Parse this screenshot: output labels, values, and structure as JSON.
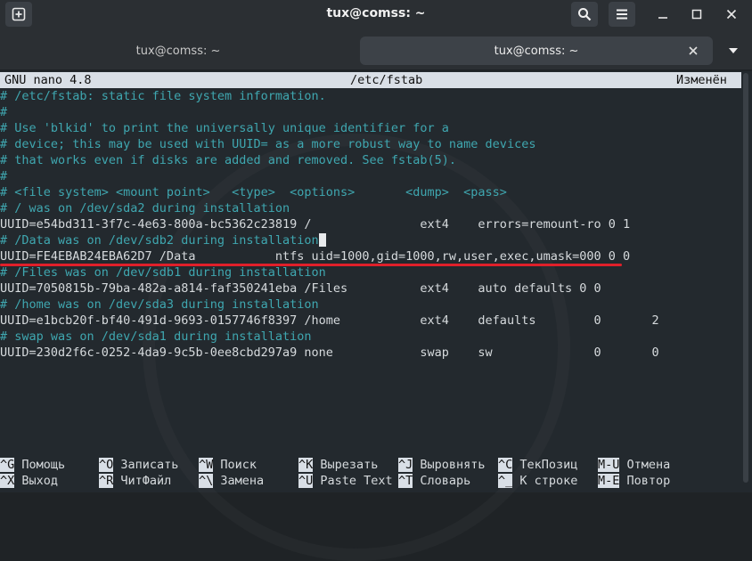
{
  "window": {
    "title": "tux@comss: ~"
  },
  "tabs": [
    {
      "label": "tux@comss: ~",
      "active": false
    },
    {
      "label": "tux@comss: ~",
      "active": true
    }
  ],
  "nano": {
    "version": "GNU nano 4.8",
    "filename": "/etc/fstab",
    "status": "Изменён"
  },
  "lines": [
    {
      "text": "# /etc/fstab: static file system information.",
      "kind": "comment"
    },
    {
      "text": "#",
      "kind": "comment"
    },
    {
      "text": "# Use 'blkid' to print the universally unique identifier for a",
      "kind": "comment"
    },
    {
      "text": "# device; this may be used with UUID= as a more robust way to name devices",
      "kind": "comment"
    },
    {
      "text": "# that works even if disks are added and removed. See fstab(5).",
      "kind": "comment"
    },
    {
      "text": "#",
      "kind": "comment"
    },
    {
      "text": "# <file system> <mount point>   <type>  <options>       <dump>  <pass>",
      "kind": "comment"
    },
    {
      "text": "# / was on /dev/sda2 during installation",
      "kind": "comment"
    },
    {
      "text": "UUID=e54bd311-3f7c-4e63-800a-bc5362c23819 /               ext4    errors=remount-ro 0 1",
      "kind": "code"
    },
    {
      "text": "# /Data was on /dev/sdb2 during installation",
      "kind": "comment",
      "cursor": true
    },
    {
      "text": "UUID=FE4EBAB24EBA62D7 /Data           ntfs uid=1000,gid=1000,rw,user,exec,umask=000 0 0",
      "kind": "code"
    },
    {
      "text": "# /Files was on /dev/sdb1 during installation",
      "kind": "comment"
    },
    {
      "text": "UUID=7050815b-79ba-482a-a814-faf350241eba /Files          ext4    auto defaults 0 0",
      "kind": "code"
    },
    {
      "text": "# /home was on /dev/sda3 during installation",
      "kind": "comment"
    },
    {
      "text": "UUID=e1bcb20f-bf40-491d-9693-0157746f8397 /home           ext4    defaults        0       2",
      "kind": "code"
    },
    {
      "text": "# swap was on /dev/sda1 during installation",
      "kind": "comment"
    },
    {
      "text": "UUID=230d2f6c-0252-4da9-9c5b-0ee8cbd297a9 none            swap    sw              0       0",
      "kind": "code"
    }
  ],
  "shortcuts_row1": [
    {
      "key": "^G",
      "label": "Помощь"
    },
    {
      "key": "^O",
      "label": "Записать"
    },
    {
      "key": "^W",
      "label": "Поиск"
    },
    {
      "key": "^K",
      "label": "Вырезать"
    },
    {
      "key": "^J",
      "label": "Выровнять"
    },
    {
      "key": "^C",
      "label": "ТекПозиц"
    },
    {
      "key": "M-U",
      "label": "Отмена"
    }
  ],
  "shortcuts_row2": [
    {
      "key": "^X",
      "label": "Выход"
    },
    {
      "key": "^R",
      "label": "ЧитФайл"
    },
    {
      "key": "^\\",
      "label": "Замена"
    },
    {
      "key": "^U",
      "label": "Paste Text"
    },
    {
      "key": "^T",
      "label": "Словарь"
    },
    {
      "key": "^_",
      "label": "К строке"
    },
    {
      "key": "M-E",
      "label": "Повтор"
    }
  ],
  "colors": {
    "comment": "#3fa7b0",
    "code": "#d6dadd",
    "highlight": "#e0202a"
  },
  "icons": {
    "new_tab": "plus-tab-icon",
    "search": "search-icon",
    "menu": "hamburger-menu-icon",
    "minimize": "minimize-icon",
    "maximize": "maximize-icon",
    "close": "close-icon",
    "tab_close": "tab-close-icon",
    "tab_dropdown": "chevron-down-icon"
  }
}
